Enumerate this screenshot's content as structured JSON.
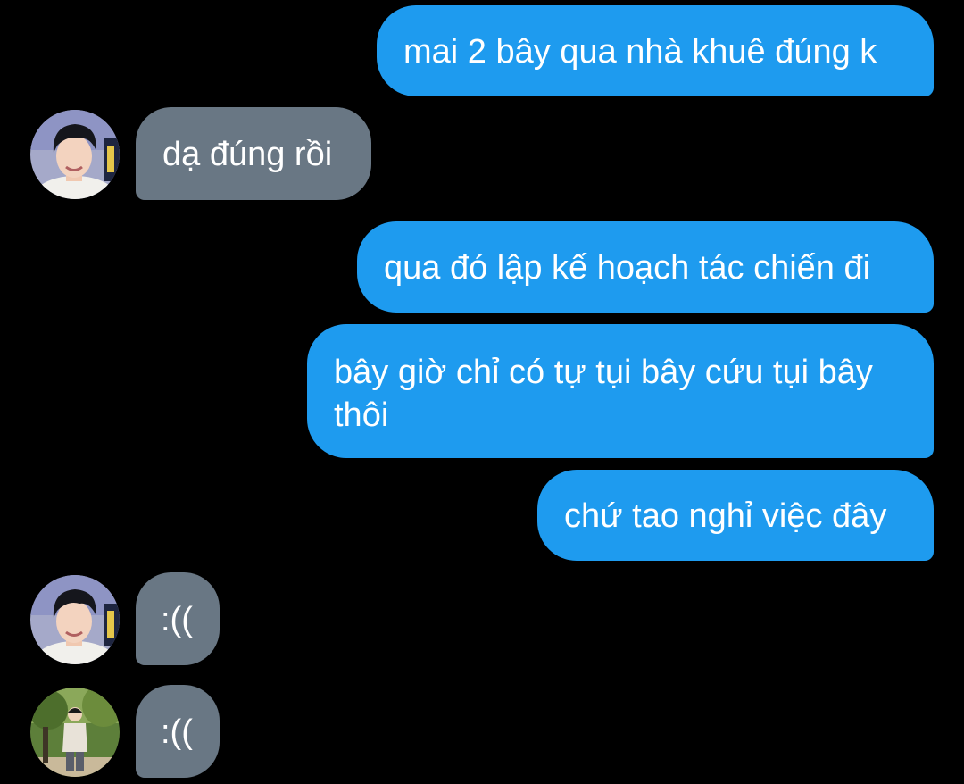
{
  "conversation": {
    "messages": [
      {
        "sender": "self",
        "text": "mai 2 bây qua nhà khuê đúng k"
      },
      {
        "sender": "contact_1",
        "text": "dạ đúng rồi"
      },
      {
        "sender": "self",
        "text": "qua đó lập kế hoạch tác chiến đi"
      },
      {
        "sender": "self",
        "text": "bây giờ chỉ có tự tụi bây cứu tụi bây thôi"
      },
      {
        "sender": "self",
        "text": "chứ tao nghỉ việc đây"
      },
      {
        "sender": "contact_1",
        "text": ":(("
      },
      {
        "sender": "contact_2",
        "text": ":(("
      }
    ]
  },
  "colors": {
    "background": "#000000",
    "outgoing_bubble": "#1e9bef",
    "incoming_bubble": "#697784",
    "bubble_text": "#ffffff"
  }
}
